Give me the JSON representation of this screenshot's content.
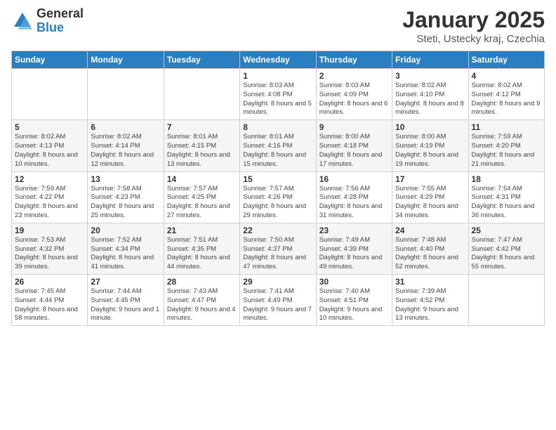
{
  "logo": {
    "general": "General",
    "blue": "Blue"
  },
  "title": "January 2025",
  "subtitle": "Steti, Ustecky kraj, Czechia",
  "weekdays": [
    "Sunday",
    "Monday",
    "Tuesday",
    "Wednesday",
    "Thursday",
    "Friday",
    "Saturday"
  ],
  "weeks": [
    [
      {
        "day": "",
        "info": ""
      },
      {
        "day": "",
        "info": ""
      },
      {
        "day": "",
        "info": ""
      },
      {
        "day": "1",
        "info": "Sunrise: 8:03 AM\nSunset: 4:08 PM\nDaylight: 8 hours and 5 minutes."
      },
      {
        "day": "2",
        "info": "Sunrise: 8:03 AM\nSunset: 4:09 PM\nDaylight: 8 hours and 6 minutes."
      },
      {
        "day": "3",
        "info": "Sunrise: 8:02 AM\nSunset: 4:10 PM\nDaylight: 8 hours and 8 minutes."
      },
      {
        "day": "4",
        "info": "Sunrise: 8:02 AM\nSunset: 4:12 PM\nDaylight: 8 hours and 9 minutes."
      }
    ],
    [
      {
        "day": "5",
        "info": "Sunrise: 8:02 AM\nSunset: 4:13 PM\nDaylight: 8 hours and 10 minutes."
      },
      {
        "day": "6",
        "info": "Sunrise: 8:02 AM\nSunset: 4:14 PM\nDaylight: 8 hours and 12 minutes."
      },
      {
        "day": "7",
        "info": "Sunrise: 8:01 AM\nSunset: 4:15 PM\nDaylight: 8 hours and 13 minutes."
      },
      {
        "day": "8",
        "info": "Sunrise: 8:01 AM\nSunset: 4:16 PM\nDaylight: 8 hours and 15 minutes."
      },
      {
        "day": "9",
        "info": "Sunrise: 8:00 AM\nSunset: 4:18 PM\nDaylight: 8 hours and 17 minutes."
      },
      {
        "day": "10",
        "info": "Sunrise: 8:00 AM\nSunset: 4:19 PM\nDaylight: 8 hours and 19 minutes."
      },
      {
        "day": "11",
        "info": "Sunrise: 7:59 AM\nSunset: 4:20 PM\nDaylight: 8 hours and 21 minutes."
      }
    ],
    [
      {
        "day": "12",
        "info": "Sunrise: 7:59 AM\nSunset: 4:22 PM\nDaylight: 8 hours and 23 minutes."
      },
      {
        "day": "13",
        "info": "Sunrise: 7:58 AM\nSunset: 4:23 PM\nDaylight: 8 hours and 25 minutes."
      },
      {
        "day": "14",
        "info": "Sunrise: 7:57 AM\nSunset: 4:25 PM\nDaylight: 8 hours and 27 minutes."
      },
      {
        "day": "15",
        "info": "Sunrise: 7:57 AM\nSunset: 4:26 PM\nDaylight: 8 hours and 29 minutes."
      },
      {
        "day": "16",
        "info": "Sunrise: 7:56 AM\nSunset: 4:28 PM\nDaylight: 8 hours and 31 minutes."
      },
      {
        "day": "17",
        "info": "Sunrise: 7:55 AM\nSunset: 4:29 PM\nDaylight: 8 hours and 34 minutes."
      },
      {
        "day": "18",
        "info": "Sunrise: 7:54 AM\nSunset: 4:31 PM\nDaylight: 8 hours and 36 minutes."
      }
    ],
    [
      {
        "day": "19",
        "info": "Sunrise: 7:53 AM\nSunset: 4:32 PM\nDaylight: 8 hours and 39 minutes."
      },
      {
        "day": "20",
        "info": "Sunrise: 7:52 AM\nSunset: 4:34 PM\nDaylight: 8 hours and 41 minutes."
      },
      {
        "day": "21",
        "info": "Sunrise: 7:51 AM\nSunset: 4:35 PM\nDaylight: 8 hours and 44 minutes."
      },
      {
        "day": "22",
        "info": "Sunrise: 7:50 AM\nSunset: 4:37 PM\nDaylight: 8 hours and 47 minutes."
      },
      {
        "day": "23",
        "info": "Sunrise: 7:49 AM\nSunset: 4:39 PM\nDaylight: 8 hours and 49 minutes."
      },
      {
        "day": "24",
        "info": "Sunrise: 7:48 AM\nSunset: 4:40 PM\nDaylight: 8 hours and 52 minutes."
      },
      {
        "day": "25",
        "info": "Sunrise: 7:47 AM\nSunset: 4:42 PM\nDaylight: 8 hours and 55 minutes."
      }
    ],
    [
      {
        "day": "26",
        "info": "Sunrise: 7:45 AM\nSunset: 4:44 PM\nDaylight: 8 hours and 58 minutes."
      },
      {
        "day": "27",
        "info": "Sunrise: 7:44 AM\nSunset: 4:45 PM\nDaylight: 9 hours and 1 minute."
      },
      {
        "day": "28",
        "info": "Sunrise: 7:43 AM\nSunset: 4:47 PM\nDaylight: 9 hours and 4 minutes."
      },
      {
        "day": "29",
        "info": "Sunrise: 7:41 AM\nSunset: 4:49 PM\nDaylight: 9 hours and 7 minutes."
      },
      {
        "day": "30",
        "info": "Sunrise: 7:40 AM\nSunset: 4:51 PM\nDaylight: 9 hours and 10 minutes."
      },
      {
        "day": "31",
        "info": "Sunrise: 7:39 AM\nSunset: 4:52 PM\nDaylight: 9 hours and 13 minutes."
      },
      {
        "day": "",
        "info": ""
      }
    ]
  ]
}
